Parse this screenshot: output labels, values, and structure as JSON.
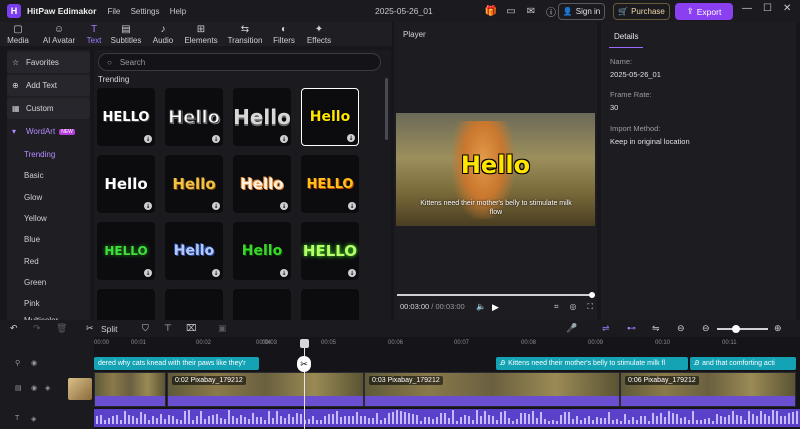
{
  "app": {
    "logo": "H",
    "name": "HitPaw Edimakor",
    "menus": [
      "File",
      "Settings",
      "Help"
    ],
    "doc_title": "2025-05-26_01",
    "sign_in": "Sign in",
    "purchase": "Purchase",
    "export": "Export"
  },
  "toolbar": {
    "tabs": [
      {
        "label": "Media",
        "icon": "folder-icon"
      },
      {
        "label": "AI Avatar",
        "icon": "avatar-icon"
      },
      {
        "label": "Text",
        "icon": "text-icon",
        "active": true
      },
      {
        "label": "Subtitles",
        "icon": "subtitles-icon"
      },
      {
        "label": "Audio",
        "icon": "music-note-icon"
      },
      {
        "label": "Elements",
        "icon": "elements-icon"
      },
      {
        "label": "Transition",
        "icon": "transition-icon"
      },
      {
        "label": "Filters",
        "icon": "filters-icon"
      },
      {
        "label": "Effects",
        "icon": "effects-icon"
      }
    ]
  },
  "sidebar": {
    "items": [
      {
        "label": "Favorites",
        "icon": "star-icon"
      },
      {
        "label": "Add Text",
        "icon": "add-text-icon"
      },
      {
        "label": "Custom",
        "icon": "custom-icon"
      },
      {
        "label": "WordArt",
        "icon": "wordart-icon",
        "badge": "NEW"
      }
    ],
    "wordart_children": [
      "Trending",
      "Basic",
      "Glow",
      "Yellow",
      "Blue",
      "Red",
      "Green",
      "Pink",
      "Multicolor"
    ]
  },
  "content": {
    "search_placeholder": "Search",
    "section_title": "Trending",
    "tiles": [
      {
        "text": "HELLO",
        "style": "a"
      },
      {
        "text": "Hello",
        "style": "b"
      },
      {
        "text": "Hello",
        "style": "c"
      },
      {
        "text": "Hello",
        "style": "d",
        "selected": true
      },
      {
        "text": "Hello",
        "style": "e"
      },
      {
        "text": "Hello",
        "style": "f"
      },
      {
        "text": "Hello",
        "style": "g"
      },
      {
        "text": "HELLO",
        "style": "h"
      },
      {
        "text": "HELLO",
        "style": "i"
      },
      {
        "text": "Hello",
        "style": "j"
      },
      {
        "text": "Hello",
        "style": "k"
      },
      {
        "text": "HELLO",
        "style": "l"
      }
    ]
  },
  "player": {
    "title": "Player",
    "overlay_title": "Hello",
    "overlay_subtitle": "Kittens need their mother's belly to stimulate milk flow",
    "current_time": "00:03:00",
    "separator": " / ",
    "total_time": "00:03:00",
    "progress": 1.0
  },
  "details": {
    "tab": "Details",
    "name_label": "Name:",
    "name_value": "2025-05-26_01",
    "fps_label": "Frame Rate:",
    "fps_value": "30",
    "import_label": "Import Method:",
    "import_value": "Keep in original location"
  },
  "timeline": {
    "split_label": "Split",
    "ruler": [
      "00:00",
      "00:01",
      "00:02",
      "00:03",
      "00:04",
      "00:05",
      "00:06",
      "00:07",
      "00:08",
      "00:09",
      "00:10",
      "00:11"
    ],
    "text_clips": [
      {
        "label": "dered why cats knead with their paws like they'r"
      },
      {
        "label": "Kittens need their mother's belly to stimulate milk fl"
      },
      {
        "label": "and that comforting acti"
      }
    ],
    "video_clips": [
      {
        "label": "0:02 Pixabay_179212"
      },
      {
        "label": "0:03 Pixabay_179212"
      },
      {
        "label": "0:06 Pixabay_179212"
      }
    ]
  },
  "colors": {
    "accent": "#8a3ff0",
    "text_clip": "#13a3b5",
    "audio": "#5b41c9"
  }
}
